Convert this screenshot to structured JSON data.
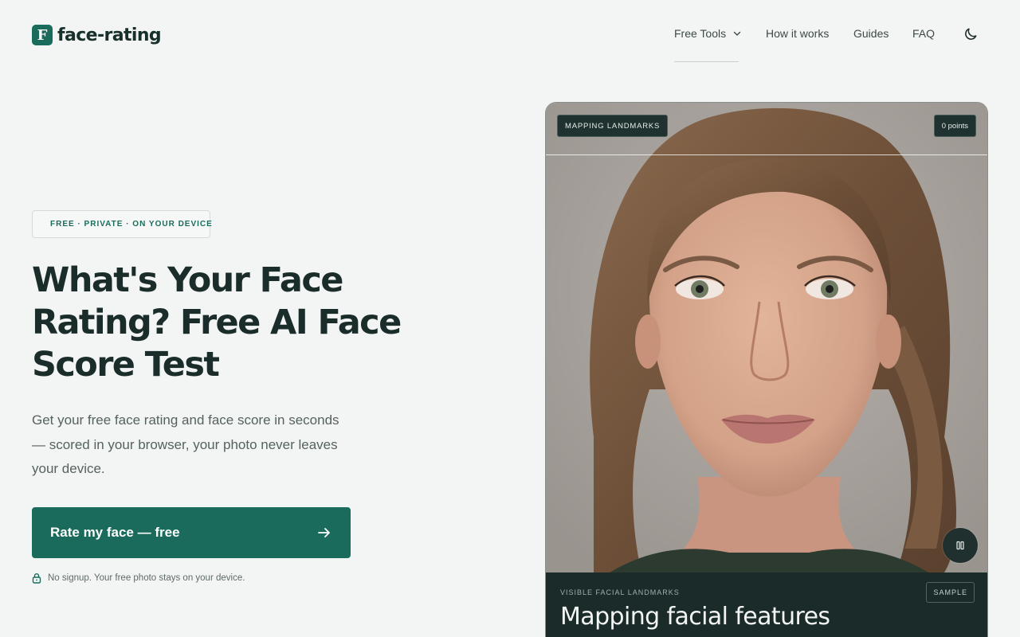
{
  "header": {
    "logo_letter": "F",
    "logo_text": "face-rating",
    "nav": {
      "free_tools": "Free Tools",
      "how_it_works": "How it works",
      "guides": "Guides",
      "faq": "FAQ"
    },
    "theme_icon": "moon-icon"
  },
  "hero": {
    "badge": "FREE · PRIVATE · ON YOUR DEVICE",
    "title": "What's Your Face Rating? Free AI Face Score Test",
    "subtitle": "Get your free face rating and face score in seconds — scored in your browser, your photo never leaves your device.",
    "cta_label": "Rate my face — free",
    "cta_icon": "arrow-right-icon",
    "privacy_note": "No signup. Your free photo stays on your device.",
    "privacy_icon": "lock-icon"
  },
  "preview": {
    "status_chip": "MAPPING LANDMARKS",
    "points_chip": "0 points",
    "pause_icon": "pause-icon",
    "panel_label": "VISIBLE FACIAL LANDMARKS",
    "panel_badge": "SAMPLE",
    "panel_title": "Mapping facial features"
  },
  "colors": {
    "accent": "#1a6b5b",
    "background": "#f3f5f4",
    "panel": "#1b2b29"
  }
}
